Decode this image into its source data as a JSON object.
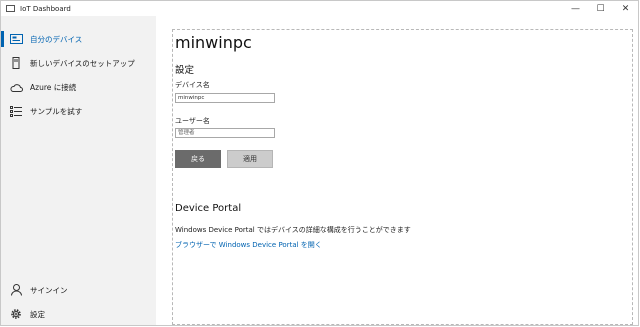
{
  "window": {
    "title": "IoT Dashboard",
    "controls": {
      "minimize": "—",
      "maximize": "☐",
      "close": "✕"
    }
  },
  "sidebar": {
    "items": [
      {
        "label": "自分のデバイス",
        "icon": "device-icon",
        "active": true
      },
      {
        "label": "新しいデバイスのセットアップ",
        "icon": "sd-card-icon",
        "active": false
      },
      {
        "label": "Azure に接続",
        "icon": "cloud-icon",
        "active": false
      },
      {
        "label": "サンプルを試す",
        "icon": "list-icon",
        "active": false
      }
    ],
    "bottom_items": [
      {
        "label": "サインイン",
        "icon": "person-icon"
      },
      {
        "label": "設定",
        "icon": "gear-icon"
      }
    ]
  },
  "main": {
    "device_name_title": "minwinpc",
    "settings_title": "設定",
    "device_name_label": "デバイス名",
    "device_name_value": "minwinpc",
    "user_name_label": "ユーザー名",
    "user_name_placeholder": "管理者",
    "back_button": "戻る",
    "apply_button": "適用",
    "portal_title": "Device Portal",
    "portal_description": "Windows Device Portal ではデバイスの詳細な構成を行うことができます",
    "portal_link": "ブラウザーで Windows Device Portal を開く"
  },
  "colors": {
    "accent": "#0063b1",
    "sidebar_bg": "#f2f2f2",
    "back_button_bg": "#6b6b6b",
    "apply_button_bg": "#cccccc"
  }
}
